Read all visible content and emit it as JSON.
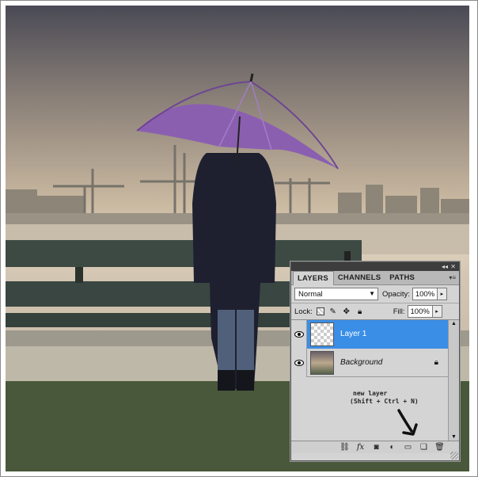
{
  "panel": {
    "tabs": [
      "LAYERS",
      "CHANNELS",
      "PATHS"
    ],
    "blend_mode": "Normal",
    "opacity_label": "Opacity:",
    "opacity_value": "100%",
    "lock_label": "Lock:",
    "fill_label": "Fill:",
    "fill_value": "100%",
    "layers": [
      {
        "name": "Layer 1",
        "selected": true,
        "visible": true
      },
      {
        "name": "Background",
        "selected": false,
        "visible": true,
        "locked": true
      }
    ],
    "annotation": {
      "line1": "new layer",
      "line2": "(Shift + Ctrl + N)"
    },
    "bottom_icons": [
      "link-icon",
      "fx-icon",
      "mask-icon",
      "adjustment-icon",
      "folder-icon",
      "new-layer-icon",
      "trash-icon"
    ],
    "colors": {
      "selected": "#3a8ee6",
      "panel": "#d4d4d4",
      "umbrella": "#8b5fb0"
    }
  }
}
